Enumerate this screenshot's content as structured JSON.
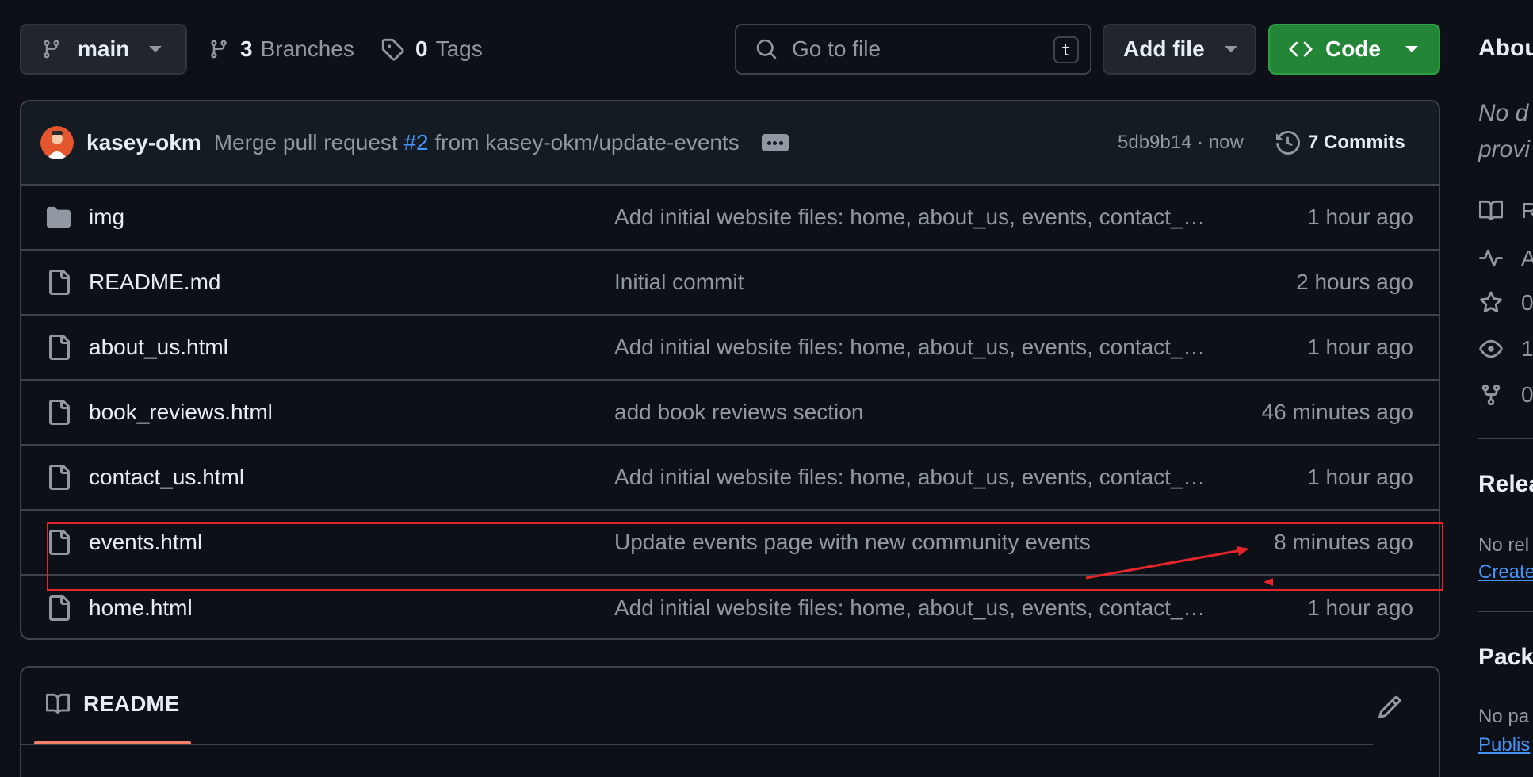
{
  "toolbar": {
    "branch": "main",
    "branches_count": "3",
    "branches_label": "Branches",
    "tags_count": "0",
    "tags_label": "Tags",
    "search_placeholder": "Go to file",
    "search_shortcut": "t",
    "add_file_label": "Add file",
    "code_label": "Code"
  },
  "latest_commit": {
    "author": "kasey-okm",
    "message_prefix": "Merge pull request",
    "pr_link": "#2",
    "message_suffix": "from kasey-okm/update-events",
    "sha_time": "5db9b14 · now",
    "commits_label": "7 Commits"
  },
  "files": [
    {
      "name": "img",
      "type": "folder",
      "message": "Add initial website files: home, about_us, events, contact_us, book_reviews",
      "time": "1 hour ago"
    },
    {
      "name": "README.md",
      "type": "file",
      "message": "Initial commit",
      "time": "2 hours ago"
    },
    {
      "name": "about_us.html",
      "type": "file",
      "message": "Add initial website files: home, about_us, events, contact_us, book_reviews",
      "time": "1 hour ago"
    },
    {
      "name": "book_reviews.html",
      "type": "file",
      "message": "add book reviews section",
      "time": "46 minutes ago"
    },
    {
      "name": "contact_us.html",
      "type": "file",
      "message": "Add initial website files: home, about_us, events, contact_us, book_reviews",
      "time": "1 hour ago"
    },
    {
      "name": "events.html",
      "type": "file",
      "message": "Update events page with new community events",
      "time": "8 minutes ago"
    },
    {
      "name": "home.html",
      "type": "file",
      "message": "Add initial website files: home, about_us, events, contact_us, book_reviews",
      "time": "1 hour ago"
    }
  ],
  "readme": {
    "tab_label": "README"
  },
  "sidebar": {
    "about_title": "Abou",
    "desc_line1": "No d",
    "desc_line2": "provi",
    "items": [
      {
        "icon": "book-icon",
        "label": "R"
      },
      {
        "icon": "pulse-icon",
        "label": "A"
      },
      {
        "icon": "star-icon",
        "label": "0"
      },
      {
        "icon": "eye-icon",
        "label": "1"
      },
      {
        "icon": "fork-icon",
        "label": "0"
      }
    ],
    "releases_title": "Relea",
    "releases_text": "No rel",
    "releases_link": "Create",
    "packages_title": "Pack",
    "packages_text": "No pa",
    "packages_link": "Publis"
  },
  "colors": {
    "background": "#0d1117",
    "accent_green": "#238636",
    "link_blue": "#4493f8",
    "annotation_red": "#e5252a",
    "tab_underline": "#f78166"
  }
}
